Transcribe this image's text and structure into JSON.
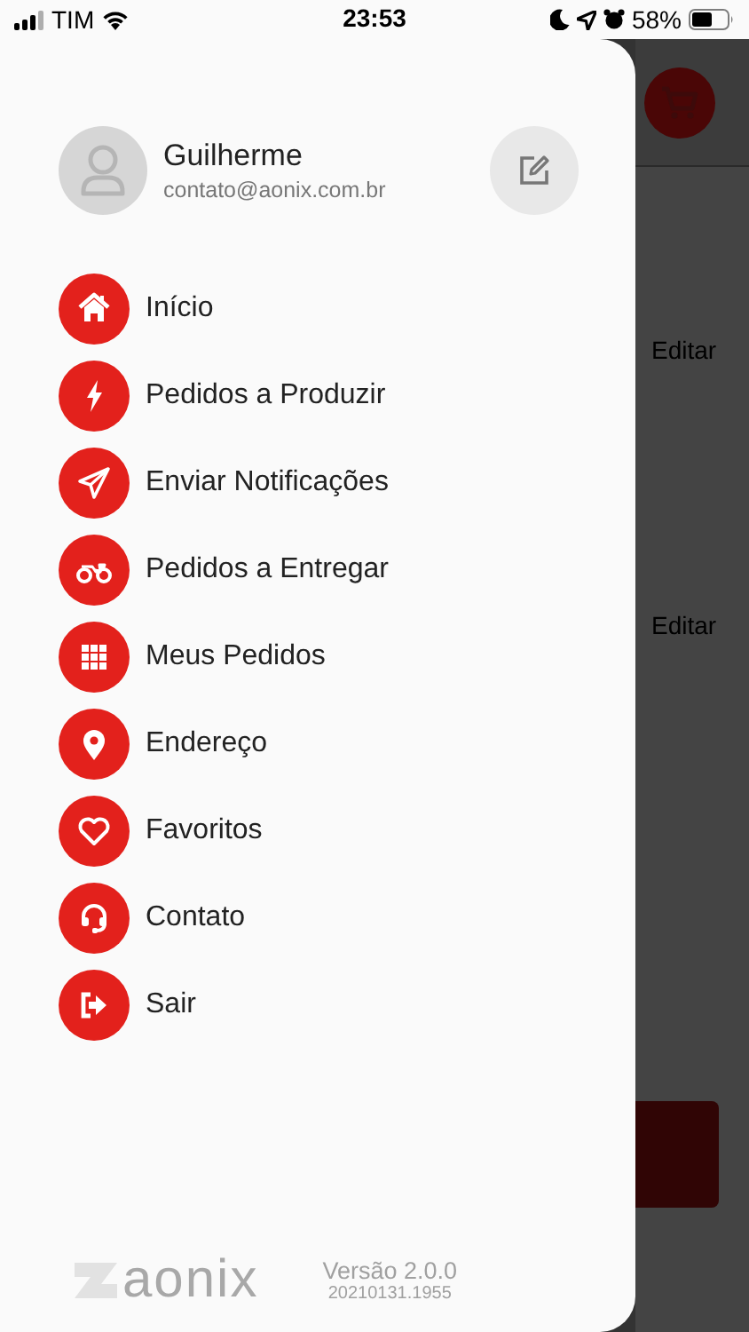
{
  "status_bar": {
    "carrier": "TIM",
    "time": "23:53",
    "battery": "58%"
  },
  "profile": {
    "name": "Guilherme",
    "email": "contato@aonix.com.br"
  },
  "menu": [
    {
      "label": "Início",
      "kind": "home"
    },
    {
      "label": "Pedidos a Produzir",
      "kind": "bolt"
    },
    {
      "label": "Enviar Notificações",
      "kind": "send"
    },
    {
      "label": "Pedidos a Entregar",
      "kind": "moto"
    },
    {
      "label": "Meus Pedidos",
      "kind": "grid"
    },
    {
      "label": "Endereço",
      "kind": "pin"
    },
    {
      "label": "Favoritos",
      "kind": "heart"
    },
    {
      "label": "Contato",
      "kind": "headset"
    },
    {
      "label": "Sair",
      "kind": "logout"
    }
  ],
  "footer": {
    "logo": "aonix",
    "version": "Versão 2.0.0",
    "build": "20210131.1955"
  },
  "background": {
    "edit_links": [
      "Editar",
      "Editar"
    ]
  }
}
